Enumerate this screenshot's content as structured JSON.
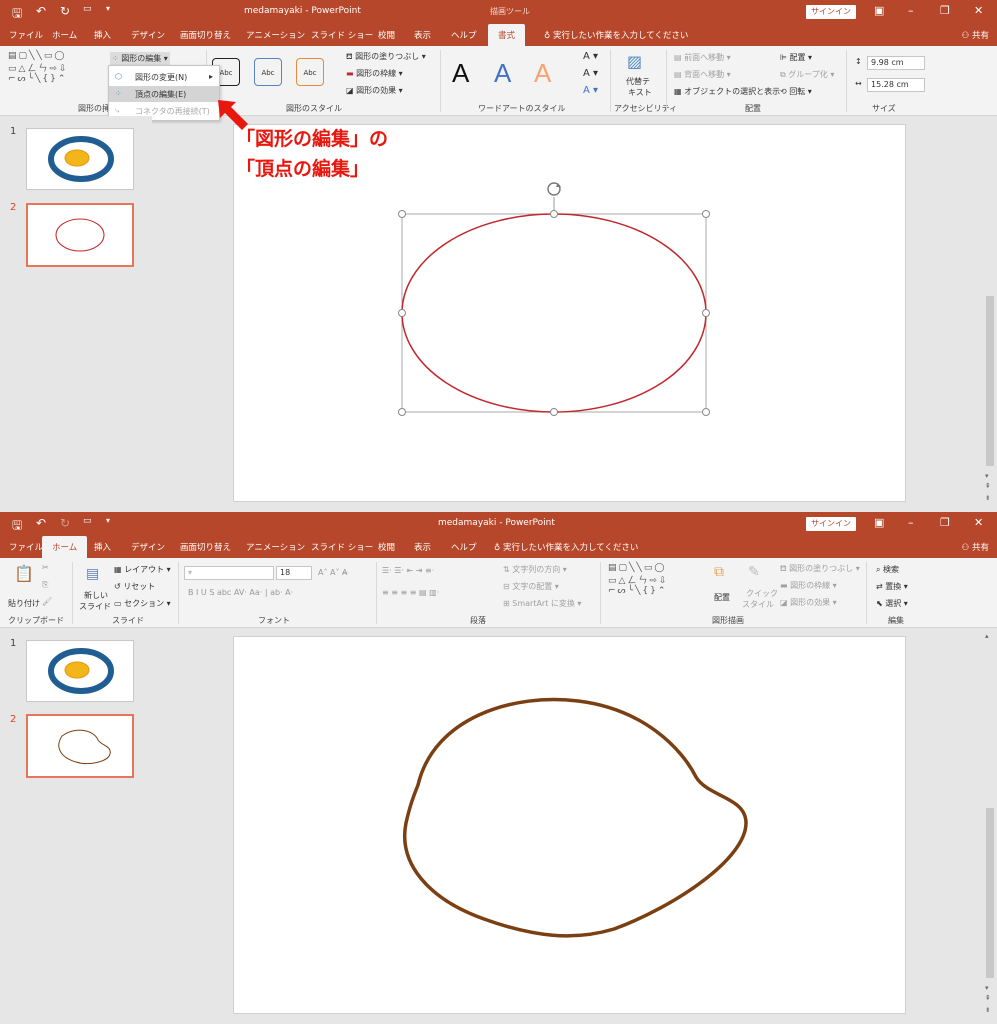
{
  "app": {
    "doc_title": "medamayaki - PowerPoint",
    "contextual_tab": "描画ツール",
    "signin": "サインイン",
    "share": "共有",
    "search_hint": "実行したい作業を入力してください"
  },
  "window1": {
    "tabs": [
      "ファイル",
      "ホーム",
      "挿入",
      "デザイン",
      "画面切り替え",
      "アニメーション",
      "スライド ショー",
      "校閲",
      "表示",
      "ヘルプ",
      "書式"
    ],
    "active_tab": "書式",
    "groups": {
      "insert_shapes": "図形の挿",
      "shape_styles": "図形のスタイル",
      "wordart_styles": "ワードアートのスタイル",
      "accessibility": "アクセシビリティ",
      "arrange": "配置",
      "size": "サイズ"
    },
    "edit_shape_btn": "図形の編集",
    "menu_items": [
      {
        "label": "図形の変更(N)",
        "state": "normal"
      },
      {
        "label": "頂点の編集(E)",
        "state": "highlighted"
      },
      {
        "label": "コネクタの再接続(T)",
        "state": "disabled"
      }
    ],
    "style_sample": "Abc",
    "wordart_letter": "A",
    "fill_label": "図形の塗りつぶし",
    "outline_label": "図形の枠線",
    "effect_label": "図形の効果",
    "alt_text_line1": "代替テ",
    "alt_text_line2": "キスト",
    "bring_forward": "前面へ移動",
    "send_backward": "背面へ移動",
    "selection_pane": "オブジェクトの選択と表示",
    "align": "配置",
    "group": "グループ化",
    "rotate": "回転",
    "height": "9.98 cm",
    "width": "15.28 cm",
    "annotation_line1": "「図形の編集」の",
    "annotation_line2": "「頂点の編集」",
    "slide_numbers": [
      "1",
      "2"
    ]
  },
  "window2": {
    "tabs": [
      "ファイル",
      "ホーム",
      "挿入",
      "デザイン",
      "画面切り替え",
      "アニメーション",
      "スライド ショー",
      "校閲",
      "表示",
      "ヘルプ"
    ],
    "active_tab": "ホーム",
    "paste": "貼り付け",
    "new_slide_1": "新しい",
    "new_slide_2": "スライド",
    "layout": "レイアウト",
    "reset": "リセット",
    "section": "セクション",
    "font_size": "18",
    "groups": {
      "clipboard": "クリップボード",
      "slides": "スライド",
      "font": "フォント",
      "paragraph": "段落",
      "drawing": "図形描画",
      "editing": "編集"
    },
    "text_direction": "文字列の方向",
    "text_align": "文字の配置",
    "smartart": "SmartArt に変換",
    "arrange": "配置",
    "quick_styles_1": "クイック",
    "quick_styles_2": "スタイル",
    "fill_label": "図形の塗りつぶし",
    "outline_label": "図形の枠線",
    "effect_label": "図形の効果",
    "find": "検索",
    "replace": "置換",
    "select": "選択",
    "slide_numbers": [
      "1",
      "2"
    ]
  },
  "colors": {
    "accent": "#b7472a",
    "ellipse": "#c0282b",
    "freeform": "#7a3f12",
    "annotation": "#e8180f"
  }
}
